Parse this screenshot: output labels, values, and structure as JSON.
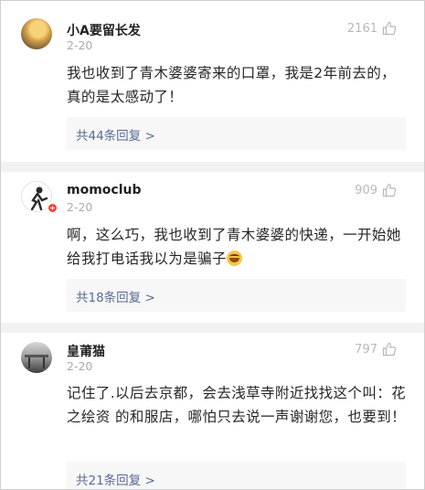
{
  "comments": [
    {
      "username": "小A要留长发",
      "date": "2-20",
      "likes": "2161",
      "text": "我也收到了青木婆婆寄来的口罩，我是2年前去的，真的是太感动了！",
      "replies": "共44条回复 >",
      "avatar_icon": "user-avatar-photo"
    },
    {
      "username": "momoclub",
      "date": "2-20",
      "likes": "909",
      "text": "啊，这么巧，我也收到了青木婆婆的快递，一开始她给我打电话我以为是骗子",
      "replies": "共18条回复 >",
      "avatar_icon": "user-avatar-photo",
      "badge": "verified-badge"
    },
    {
      "username": "皇莆猫",
      "date": "2-20",
      "likes": "797",
      "text": "记住了.以后去京都，会去浅草寺附近找找这个叫：花之绘资 的和服店，哪怕只去说一声谢谢您，也要到！",
      "replies": "共21条回复 >",
      "avatar_icon": "user-avatar-photo"
    }
  ],
  "icons": {
    "like": "thumbs-up-icon",
    "emoji": "laughing-tears-emoji"
  },
  "colors": {
    "link": "#576b95",
    "meta": "#aaaaaa",
    "badge": "#ff3b30",
    "divider": "#f2f2f2"
  }
}
